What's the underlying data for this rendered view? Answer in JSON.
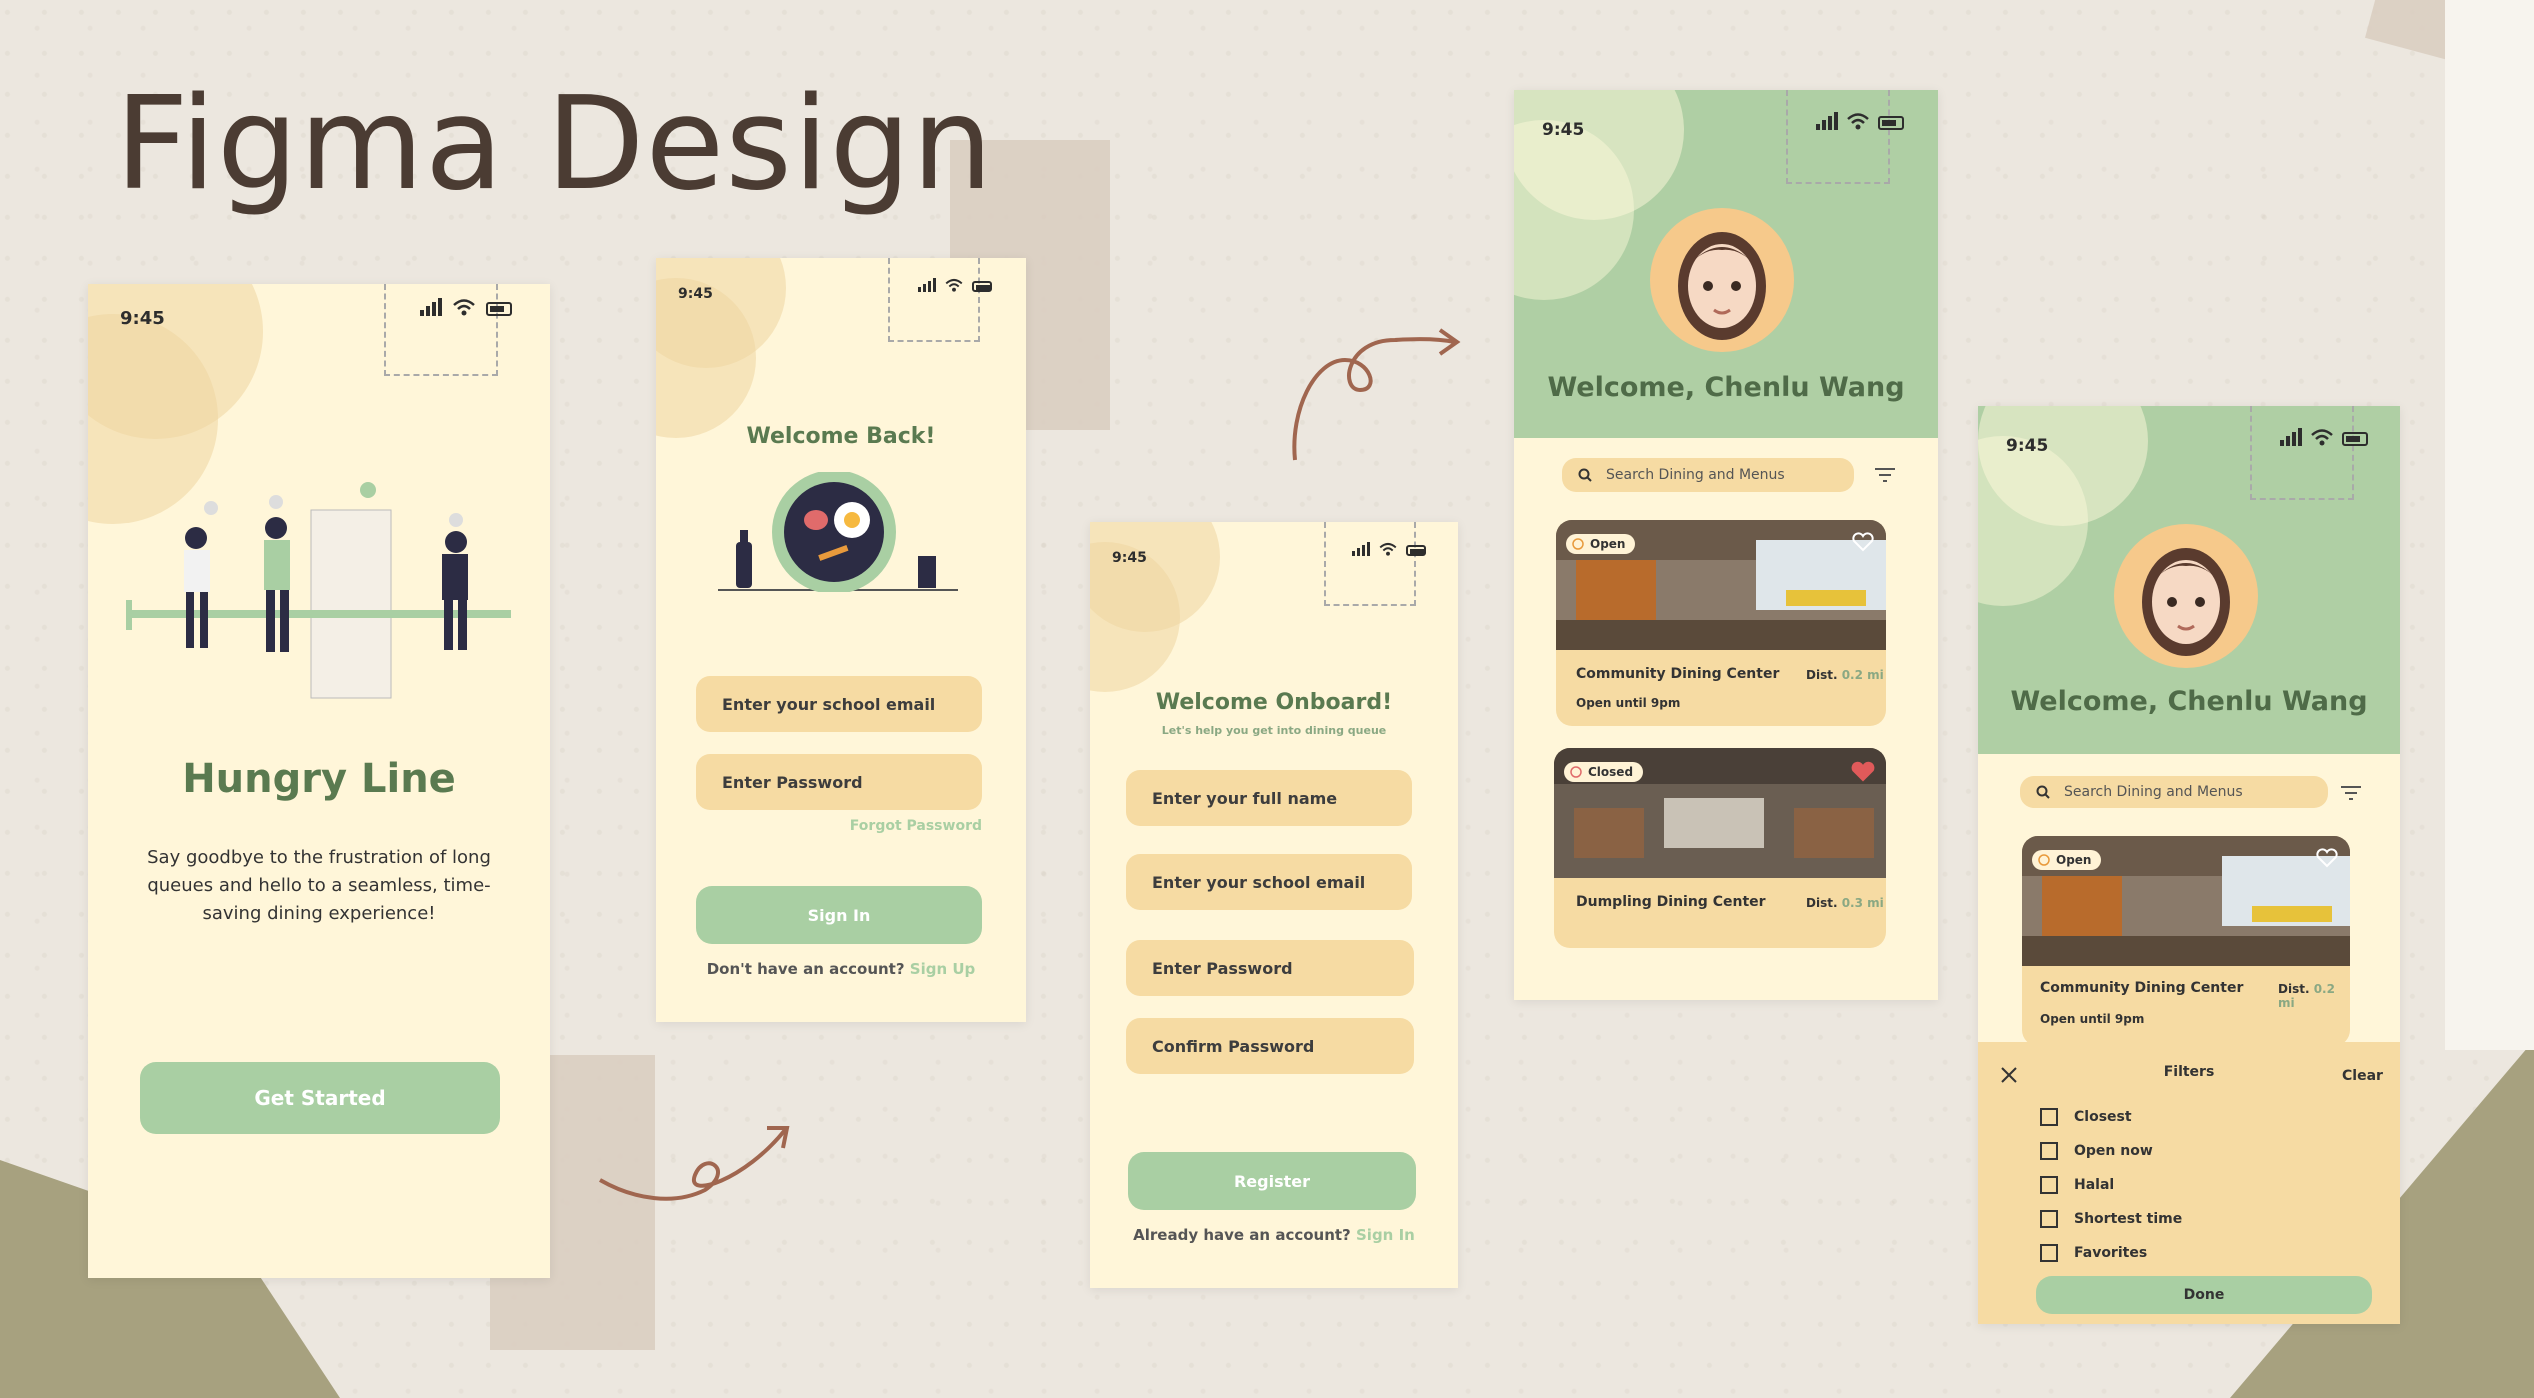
{
  "title": "Figma Design",
  "colors": {
    "accent_green": "#a9cfa3",
    "cream": "#fff6d9",
    "field": "#f6dba3",
    "heading_green": "#5a7a50"
  },
  "status_time": "9:45",
  "screen1": {
    "app_name": "Hungry Line",
    "tagline_1": "Say goodbye to the frustration of long",
    "tagline_2": "queues and hello to a seamless,  time-",
    "tagline_3": "saving dining experience!",
    "cta": "Get Started"
  },
  "screen2": {
    "heading": "Welcome Back!",
    "email_placeholder": "Enter your school email",
    "password_placeholder": "Enter Password",
    "forgot": "Forgot Password",
    "sign_in": "Sign In",
    "no_account": "Don't have an account?",
    "sign_up": "Sign Up"
  },
  "screen3": {
    "heading": "Welcome Onboard!",
    "subheading": "Let's help you get into dining queue",
    "name_placeholder": "Enter your full name",
    "email_placeholder": "Enter your school email",
    "password_placeholder": "Enter Password",
    "confirm_placeholder": "Confirm Password",
    "register": "Register",
    "have_account": "Already have an account?",
    "sign_in": "Sign In"
  },
  "screen4": {
    "welcome": "Welcome, Chenlu Wang",
    "search_placeholder": "Search Dining and Menus",
    "cards": [
      {
        "status": "Open",
        "name": "Community Dining Center",
        "dist_label": "Dist.",
        "dist": "0.2 mi",
        "hours": "Open until 9pm"
      },
      {
        "status": "Closed",
        "name": "Dumpling Dining Center",
        "dist_label": "Dist.",
        "dist": "0.3 mi"
      }
    ]
  },
  "screen5": {
    "welcome": "Welcome, Chenlu Wang",
    "search_placeholder": "Search Dining and Menus",
    "card": {
      "status": "Open",
      "name": "Community Dining Center",
      "dist_label": "Dist.",
      "dist": "0.2 mi",
      "hours": "Open until 9pm"
    },
    "filters": {
      "title": "Filters",
      "clear": "Clear",
      "options": [
        "Closest",
        "Open now",
        "Halal",
        "Shortest time",
        "Favorites"
      ],
      "done": "Done"
    }
  }
}
